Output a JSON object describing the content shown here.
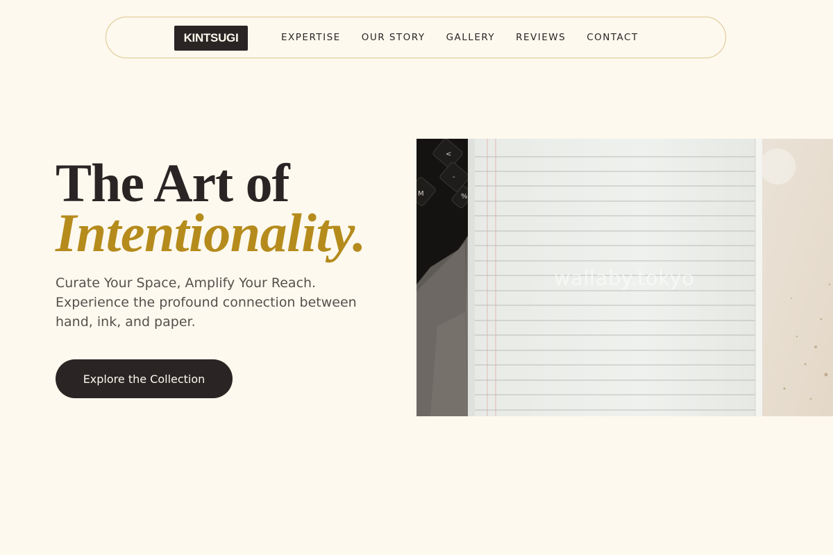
{
  "nav": {
    "logo": "KINTSUGI",
    "links": [
      "EXPERTISE",
      "OUR STORY",
      "GALLERY",
      "REVIEWS",
      "CONTACT"
    ]
  },
  "hero": {
    "title_line1": "The Art of",
    "title_line2": "Intentionality.",
    "subtitle": "Curate Your Space, Amplify Your Reach. Experience the profound connection between hand, ink, and paper.",
    "cta_label": "Explore the Collection",
    "image": {
      "description_icon": "notebook-photo",
      "watermark": "wallaby.tokyo"
    }
  },
  "colors": {
    "background": "#fdf9ee",
    "ink": "#2a2524",
    "accent_gold": "#b58b1c",
    "nav_border": "#dcc48f"
  }
}
